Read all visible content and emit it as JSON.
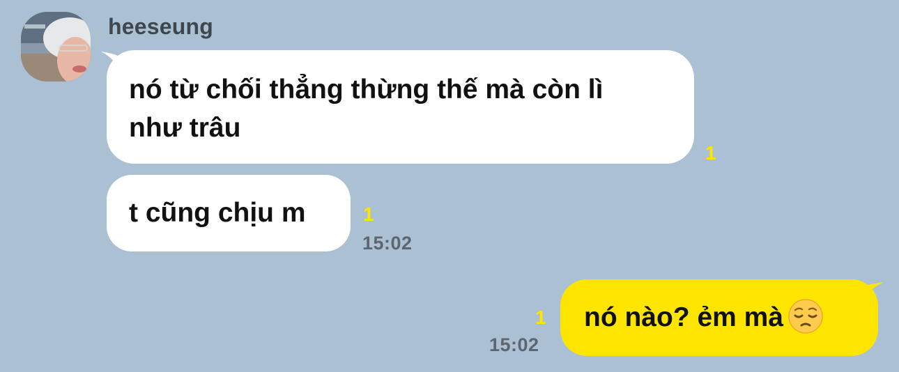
{
  "sender": {
    "name": "heeseung"
  },
  "messages": [
    {
      "direction": "incoming",
      "text_line1": "nó từ chối thẳng thừng thế mà còn lì",
      "text_line2": "như trâu",
      "unread": "1"
    },
    {
      "direction": "incoming",
      "text": "t cũng chịu m",
      "unread": "1",
      "time": "15:02"
    },
    {
      "direction": "outgoing",
      "text": "nó nào? ẻm mà",
      "emoji": "pensive-face-icon",
      "unread": "1",
      "time": "15:02"
    }
  ],
  "colors": {
    "background": "#abc1d3",
    "incoming_bubble": "#ffffff",
    "outgoing_bubble": "#fee500",
    "unread_count": "#fee500",
    "timestamp": "#5d6670",
    "sender_name": "#3e4650"
  }
}
